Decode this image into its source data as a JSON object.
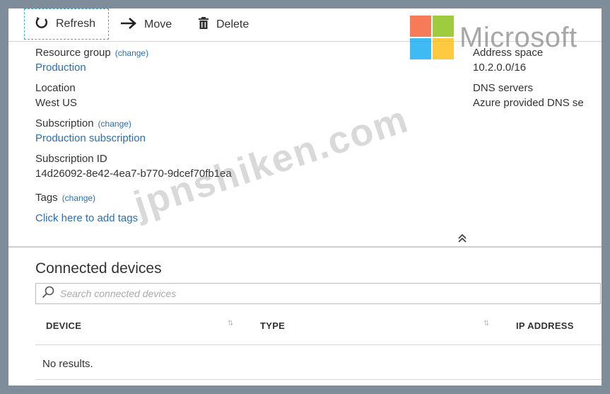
{
  "toolbar": {
    "refresh_label": "Refresh",
    "move_label": "Move",
    "delete_label": "Delete"
  },
  "fields": {
    "resource_group_label": "Resource group",
    "resource_group_change": "(change)",
    "resource_group_value": "Production",
    "location_label": "Location",
    "location_value": "West US",
    "subscription_label": "Subscription",
    "subscription_change": "(change)",
    "subscription_value": "Production subscription",
    "subscription_id_label": "Subscription ID",
    "subscription_id_value": "14d26092-8e42-4ea7-b770-9dcef70fb1ea",
    "tags_label": "Tags",
    "tags_change": "(change)",
    "tags_add": "Click here to add tags",
    "address_space_label": "Address space",
    "address_space_value": "10.2.0.0/16",
    "dns_label": "DNS servers",
    "dns_value": "Azure provided DNS se"
  },
  "devices": {
    "title": "Connected devices",
    "search_placeholder": "Search connected devices",
    "columns": [
      "DEVICE",
      "TYPE",
      "IP ADDRESS"
    ],
    "empty_text": "No results."
  },
  "branding": {
    "logo_text": "Microsoft",
    "logo_colors": [
      "#f25022",
      "#7fba00",
      "#00a4ef",
      "#ffb900"
    ],
    "watermark": "jpnshiken.com"
  },
  "icons": {
    "refresh": "refresh-icon",
    "move": "arrow-right-icon",
    "delete": "trash-icon",
    "collapse": "double-chevron-up-icon",
    "search": "search-icon",
    "sort": "sort-icon"
  }
}
